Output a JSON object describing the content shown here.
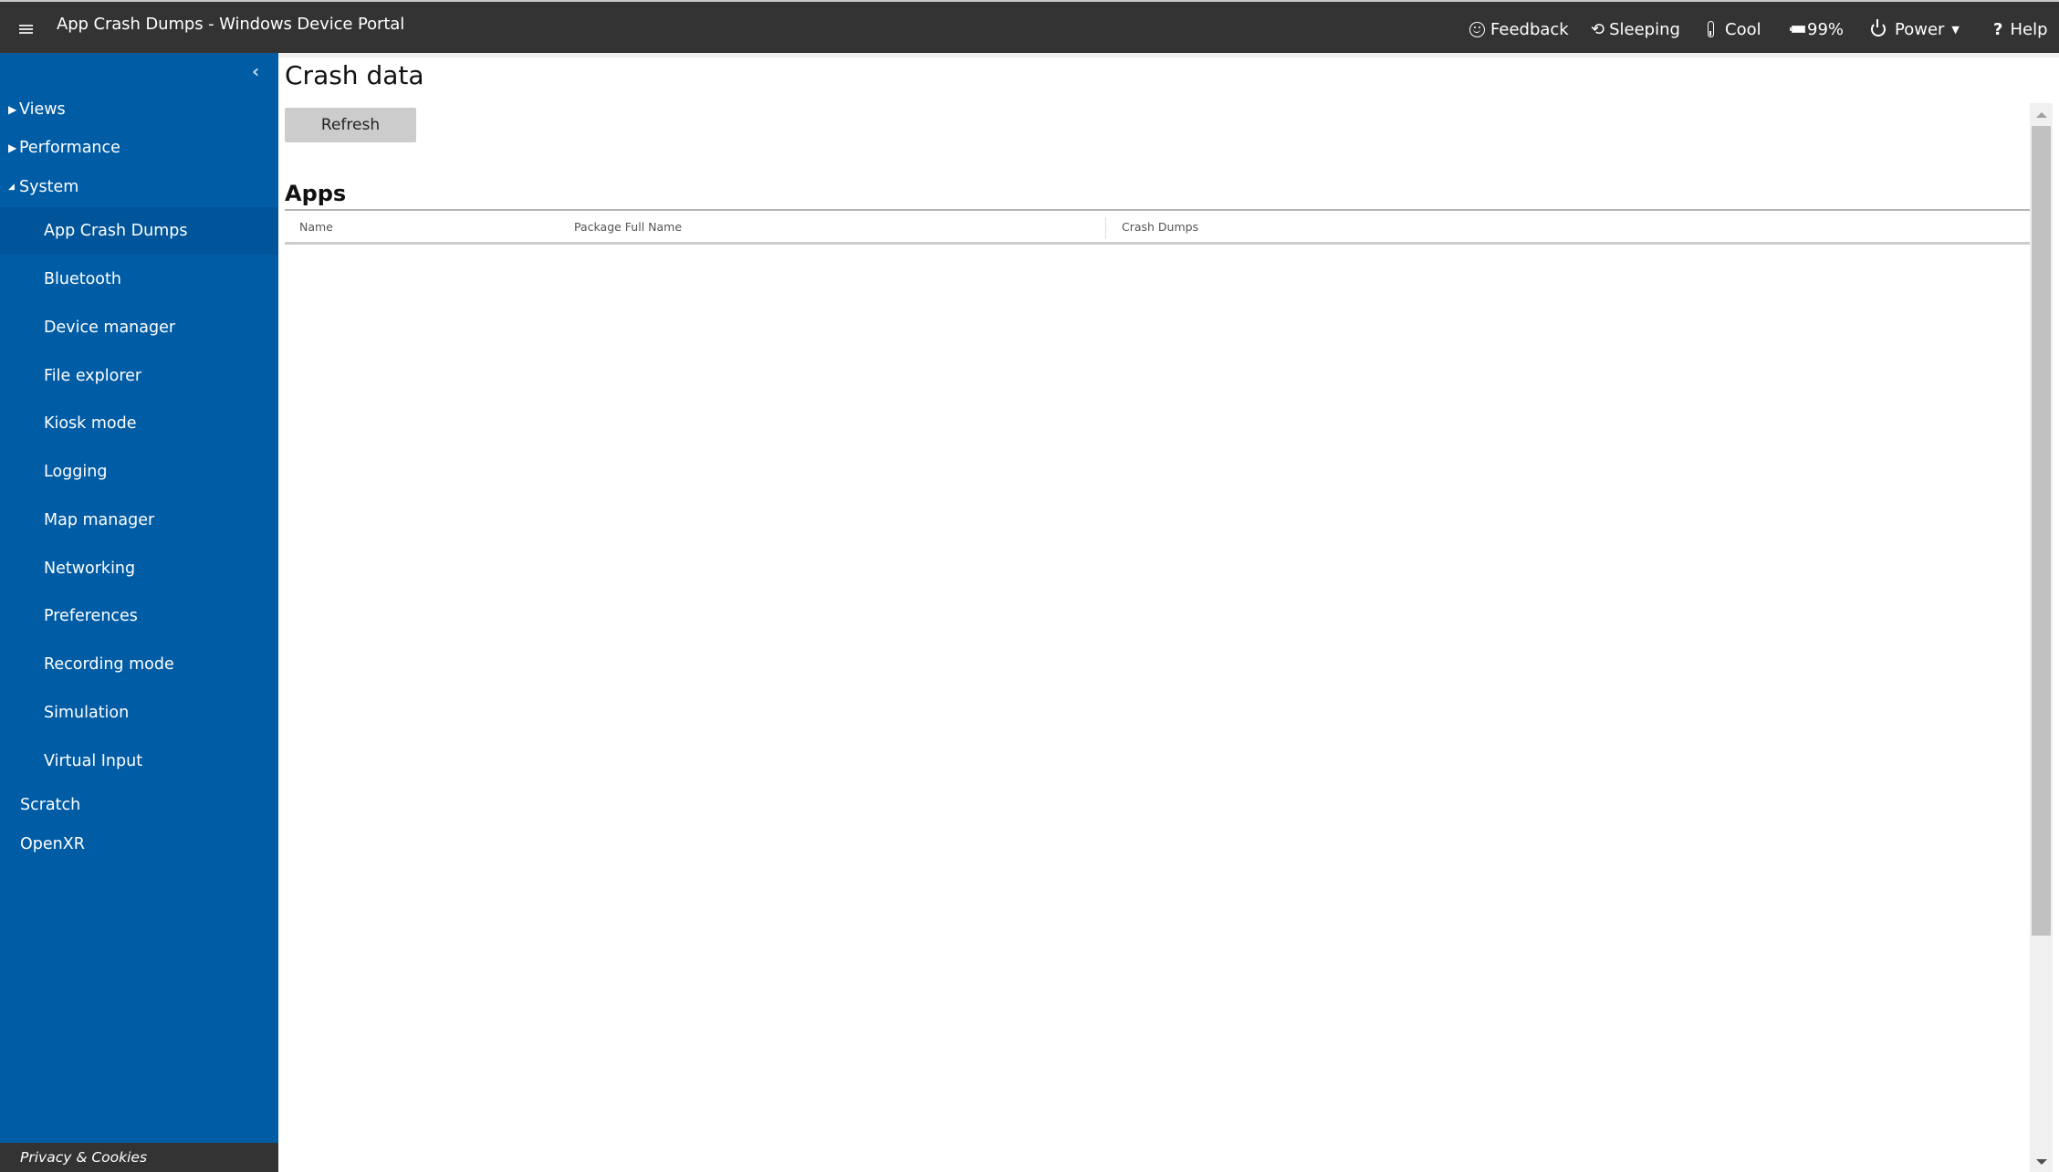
{
  "header": {
    "menu_icon": "hamburger-icon",
    "title": "App Crash Dumps - Windows Device Portal",
    "items": [
      {
        "icon": "smiley-icon",
        "label": "Feedback"
      },
      {
        "icon": "history-icon",
        "label": "Sleeping"
      },
      {
        "icon": "thermometer-icon",
        "label": "Cool"
      },
      {
        "icon": "battery-icon",
        "label": "99%"
      },
      {
        "icon": "power-icon",
        "label": "Power",
        "dropdown": true
      },
      {
        "icon": "help-icon",
        "label": "Help"
      }
    ],
    "sleeping_glyph": "⟲",
    "help_glyph": "?",
    "caret_glyph": "▼"
  },
  "sidebar": {
    "collapse_glyph": "‹",
    "groups": [
      {
        "label": "Views",
        "expanded": false,
        "arrow": "▶"
      },
      {
        "label": "Performance",
        "expanded": false,
        "arrow": "▶"
      },
      {
        "label": "System",
        "expanded": true,
        "arrow": "◢"
      }
    ],
    "system_items": [
      {
        "label": "App Crash Dumps",
        "selected": true
      },
      {
        "label": "Bluetooth"
      },
      {
        "label": "Device manager"
      },
      {
        "label": "File explorer"
      },
      {
        "label": "Kiosk mode"
      },
      {
        "label": "Logging"
      },
      {
        "label": "Map manager"
      },
      {
        "label": "Networking"
      },
      {
        "label": "Preferences"
      },
      {
        "label": "Recording mode"
      },
      {
        "label": "Simulation"
      },
      {
        "label": "Virtual Input"
      }
    ],
    "other_items": [
      {
        "label": "Scratch"
      },
      {
        "label": "OpenXR"
      }
    ],
    "footer_link": "Privacy & Cookies",
    "colors": {
      "background": "#005ca5",
      "selected": "#00549a"
    }
  },
  "main": {
    "title": "Crash data",
    "refresh_label": "Refresh",
    "apps_section": {
      "title": "Apps",
      "columns": [
        "Name",
        "Package Full Name",
        "Crash Dumps"
      ],
      "rows": []
    }
  },
  "colors": {
    "header_bg": "#333333",
    "button_bg": "#cccccc"
  }
}
